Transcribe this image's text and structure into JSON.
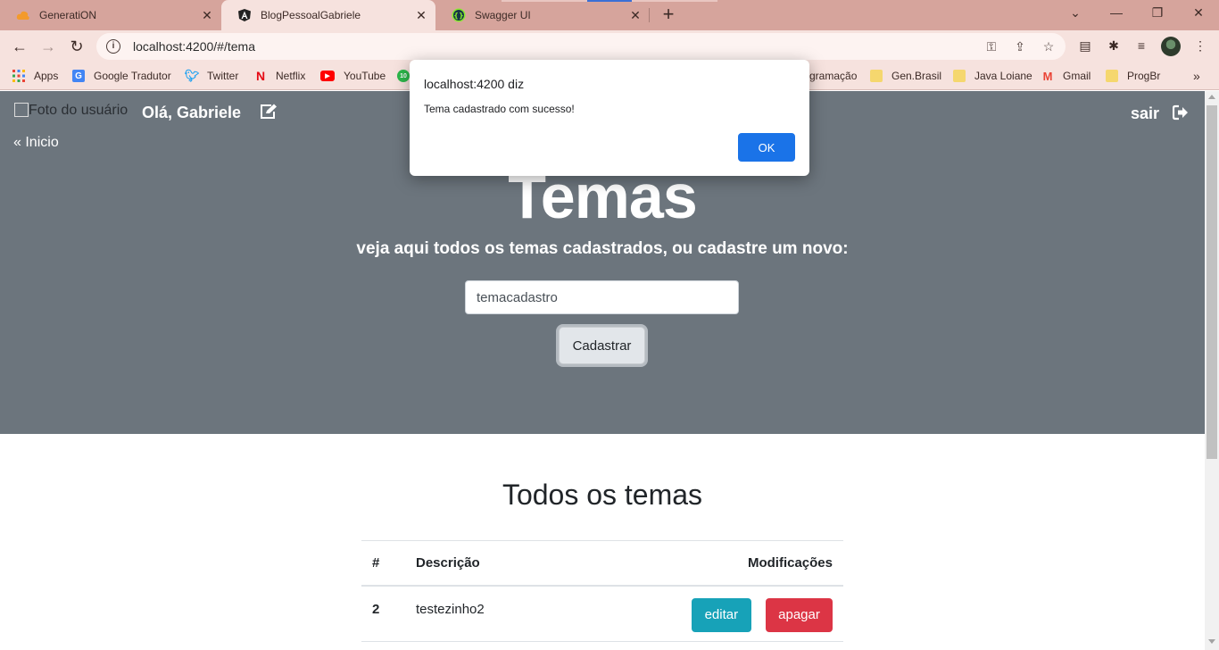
{
  "browser": {
    "tabs": [
      {
        "title": "GeneratiON",
        "icon": "cloud-icon"
      },
      {
        "title": "BlogPessoalGabriele",
        "icon": "angular-icon"
      },
      {
        "title": "Swagger UI",
        "icon": "swagger-icon"
      }
    ],
    "address": "localhost:4200/#/tema",
    "bookmarks": [
      {
        "label": "Apps",
        "icon": "apps-grid-icon"
      },
      {
        "label": "Google Tradutor",
        "icon": "google-translate-icon"
      },
      {
        "label": "Twitter",
        "icon": "twitter-icon"
      },
      {
        "label": "Netflix",
        "icon": "netflix-icon"
      },
      {
        "label": "YouTube",
        "icon": "youtube-icon"
      },
      {
        "label": "gramação",
        "icon": "folder-icon"
      },
      {
        "label": "Gen.Brasil",
        "icon": "folder-icon"
      },
      {
        "label": "Java Loiane",
        "icon": "folder-icon"
      },
      {
        "label": "Gmail",
        "icon": "gmail-icon"
      },
      {
        "label": "ProgBr",
        "icon": "folder-icon"
      }
    ],
    "more_bookmarks": "»"
  },
  "header": {
    "user_photo_alt": "Foto do usuário",
    "greeting": "Olá, Gabriele",
    "home_link": "Inicio",
    "logout": "sair"
  },
  "hero": {
    "title": "Temas",
    "subtitle": "veja aqui todos os temas cadastrados, ou cadastre um novo:",
    "input_value": "temacadastro",
    "submit_label": "Cadastrar"
  },
  "list": {
    "title": "Todos os temas",
    "columns": [
      "#",
      "Descrição",
      "Modificações"
    ],
    "rows": [
      {
        "id": "2",
        "descricao": "testezinho2",
        "edit_label": "editar",
        "delete_label": "apagar"
      }
    ]
  },
  "dialog": {
    "title": "localhost:4200 diz",
    "message": "Tema cadastrado com sucesso!",
    "ok_label": "OK"
  },
  "colors": {
    "hero_bg": "#6c757d",
    "tab_strip": "#d6a49c",
    "edit_button": "#17a2b8",
    "delete_button": "#dc3545",
    "dialog_ok": "#1a73e8"
  }
}
